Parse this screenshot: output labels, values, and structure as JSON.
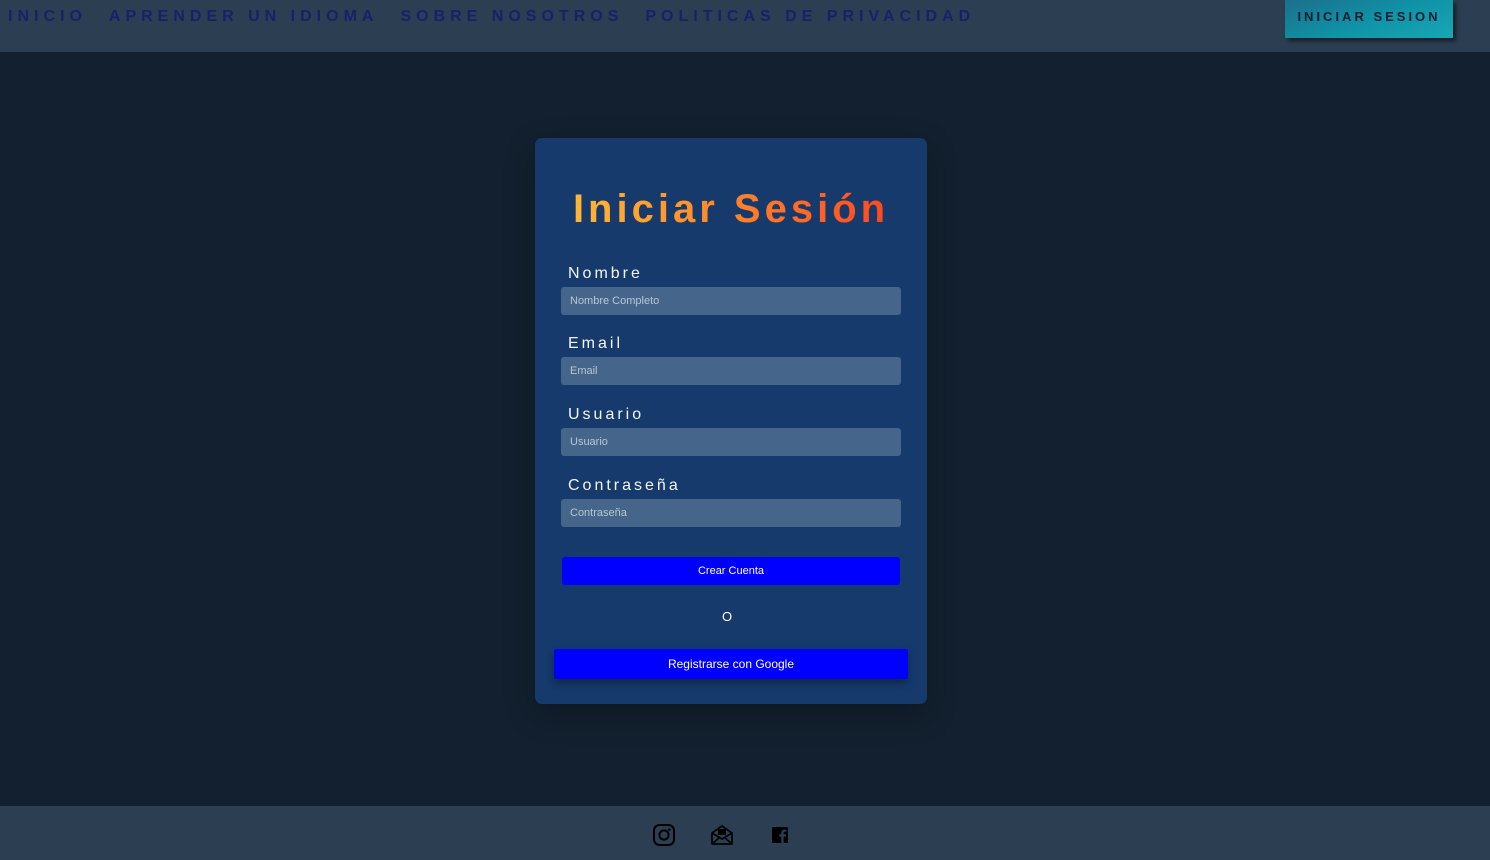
{
  "nav": {
    "items": [
      {
        "label": "INICIO"
      },
      {
        "label": "APRENDER UN IDIOMA"
      },
      {
        "label": "SOBRE NOSOTROS"
      },
      {
        "label": "POLITICAS DE PRIVACIDAD"
      }
    ],
    "login_button": "INICIAR SESION"
  },
  "form": {
    "title_part1": "Iniciar",
    "title_part2": "Sesión",
    "fields": [
      {
        "label": "Nombre",
        "placeholder": "Nombre Completo",
        "value": ""
      },
      {
        "label": "Email",
        "placeholder": "Email",
        "value": ""
      },
      {
        "label": "Usuario",
        "placeholder": "Usuario",
        "value": ""
      },
      {
        "label": "Contraseña",
        "placeholder": "Contraseña",
        "value": ""
      }
    ],
    "create_button": "Crear Cuenta",
    "separator": "O",
    "google_button": "Registrarse con Google"
  },
  "footer": {
    "icons": [
      "instagram-icon",
      "mail-icon",
      "facebook-icon"
    ]
  },
  "colors": {
    "page_background": "#12202f",
    "bar_background": "#2b3e52",
    "card_background": "#163a6b",
    "input_background": "#45658a",
    "button_blue": "#0000ff",
    "title_gradient_start": "#ffc23a",
    "title_gradient_end": "#ff3a1c",
    "login_button_teal": "#0f94a8"
  }
}
